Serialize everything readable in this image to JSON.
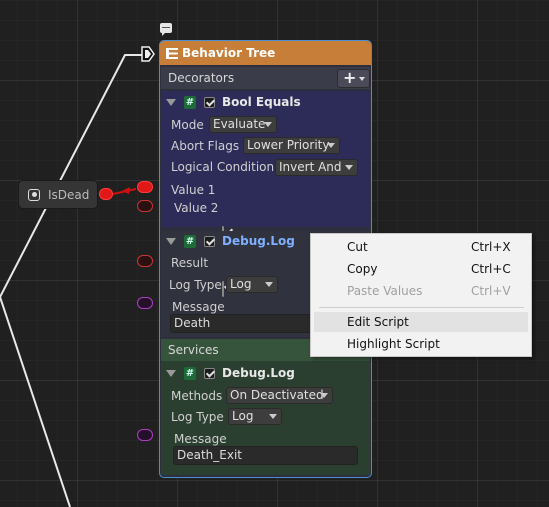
{
  "behavior_tree_node": {
    "title": "Behavior Tree",
    "decorators_header": "Decorators",
    "add_button": "+",
    "bool_equals": {
      "title": "Bool Equals",
      "hash_icon": "#",
      "mode_label": "Mode",
      "mode_value": "Evaluate",
      "abort_flags_label": "Abort Flags",
      "abort_flags_value": "Lower Priority",
      "logical_condition_label": "Logical Condition",
      "logical_condition_value": "Invert And",
      "value1_label": "Value 1",
      "value2_label": "Value 2"
    },
    "debug_log_1": {
      "title": "Debug.Log",
      "hash_icon": "#",
      "result_label": "Result",
      "log_type_label": "Log Type",
      "log_type_value": "Log",
      "message_label": "Message",
      "message_value": "Death"
    },
    "services_header": "Services",
    "debug_log_2": {
      "title": "Debug.Log",
      "hash_icon": "#",
      "methods_label": "Methods",
      "methods_value": "On Deactivated",
      "log_type_label": "Log Type",
      "log_type_value": "Log",
      "message_label": "Message",
      "message_value": "Death_Exit"
    }
  },
  "isdead_node": {
    "label": "IsDead",
    "icon": "radio-icon"
  },
  "context_menu": {
    "items": [
      {
        "label": "Cut",
        "shortcut": "Ctrl+X",
        "enabled": true
      },
      {
        "label": "Copy",
        "shortcut": "Ctrl+C",
        "enabled": true
      },
      {
        "label": "Paste Values",
        "shortcut": "Ctrl+V",
        "enabled": false
      },
      {
        "label": "Edit Script",
        "shortcut": "",
        "enabled": true
      },
      {
        "label": "Highlight Script",
        "shortcut": "",
        "enabled": true
      }
    ]
  },
  "colors": {
    "header_orange": "#c77e38",
    "decorator_purple": "#2d2c58",
    "service_green": "#2b3f30",
    "node_border": "#4a8fd0",
    "port_red": "#e01818",
    "port_purple": "#b03cc8"
  }
}
